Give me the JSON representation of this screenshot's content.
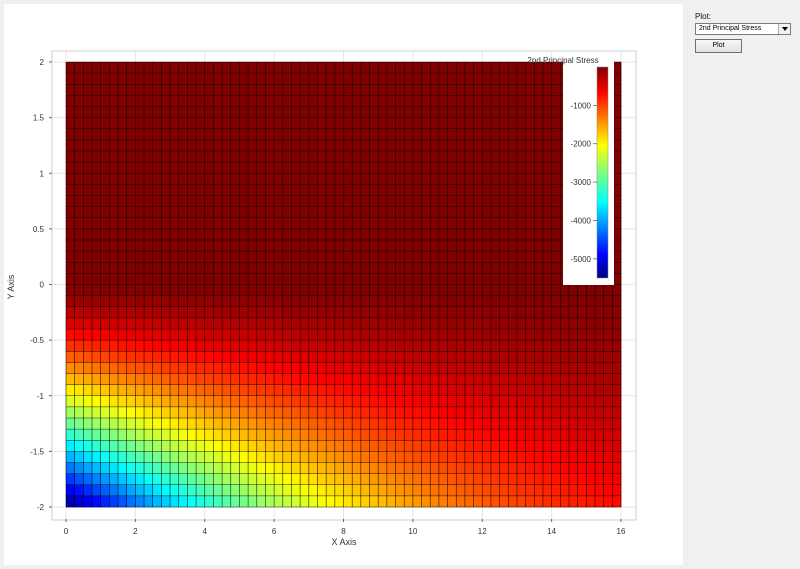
{
  "chart_data": {
    "type": "heatmap",
    "title": "",
    "xlabel": "X Axis",
    "ylabel": "Y Axis",
    "xlim": [
      0,
      16
    ],
    "ylim": [
      -2,
      2
    ],
    "x_ticks": [
      0,
      2,
      4,
      6,
      8,
      10,
      12,
      14,
      16
    ],
    "x_tick_labels": [
      "0",
      "2",
      "4",
      "6",
      "8",
      "10",
      "12",
      "14",
      "16"
    ],
    "y_ticks": [
      2,
      1.5,
      1,
      0.5,
      0,
      -0.5,
      -1,
      -1.5,
      -2
    ],
    "y_tick_labels": [
      "2",
      "1.5",
      "1",
      "0.5",
      "0",
      "-0.5",
      "-1",
      "-1.5",
      "-2"
    ],
    "mesh": {
      "nx": 64,
      "ny": 40
    },
    "field": "2nd Principal Stress",
    "value_description": "Values near 0 across the upper half; most negative (about -5500) at bottom-left (x=0, y=-2), rising toward 0 to the right and upward.",
    "min_value": -5500,
    "max_value": 0,
    "colorbar": {
      "title": "2nd Principal Stress",
      "colormap": "jet",
      "range": [
        -5500,
        0
      ],
      "ticks": [
        -1000,
        -2000,
        -3000,
        -4000,
        -5000
      ],
      "tick_labels": [
        "-1000",
        "-2000",
        "-3000",
        "-4000",
        "-5000"
      ]
    },
    "grid": true
  },
  "controls": {
    "plot_label": "Plot:",
    "plot_select_value": "2nd Principal Stress",
    "plot_button_label": "Plot"
  },
  "colors": {
    "panel_background": "#ffffff",
    "window_background": "#f0f0f0",
    "mesh_line": "#000000"
  }
}
